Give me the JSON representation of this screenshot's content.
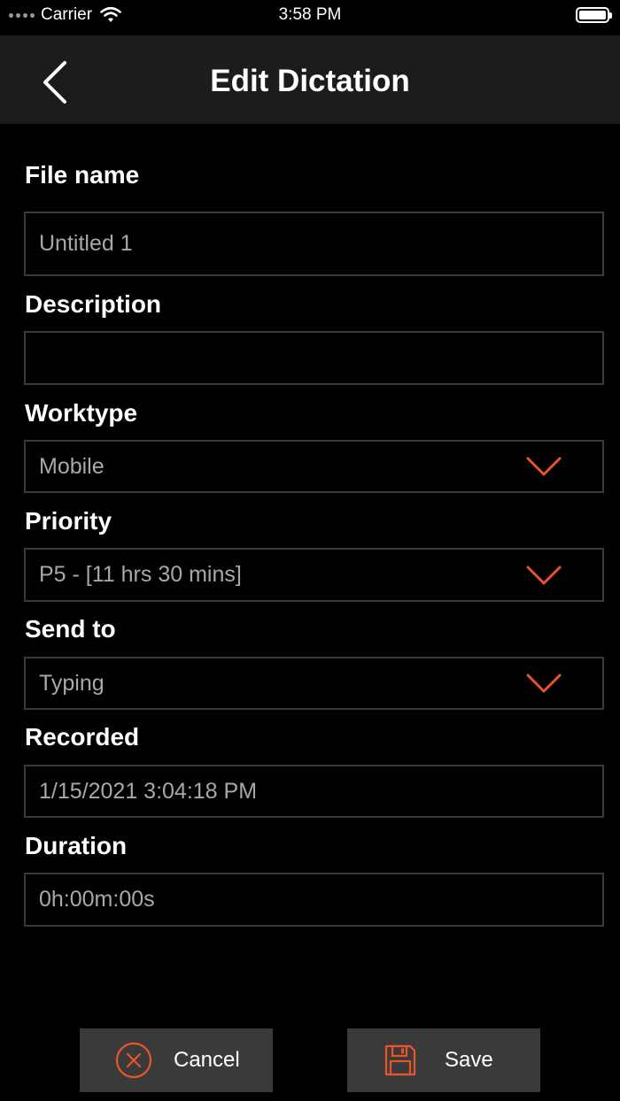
{
  "status_bar": {
    "carrier": "Carrier",
    "time": "3:58 PM"
  },
  "nav": {
    "title": "Edit Dictation",
    "back_icon": "chevron-left-icon"
  },
  "form": {
    "file_name": {
      "label": "File name",
      "value": "Untitled 1"
    },
    "description": {
      "label": "Description",
      "value": ""
    },
    "worktype": {
      "label": "Worktype",
      "value": "Mobile"
    },
    "priority": {
      "label": "Priority",
      "value": "P5 - [11 hrs 30 mins]"
    },
    "send_to": {
      "label": "Send to",
      "value": "Typing"
    },
    "recorded": {
      "label": "Recorded",
      "value": "1/15/2021 3:04:18 PM"
    },
    "duration": {
      "label": "Duration",
      "value": "0h:00m:00s"
    }
  },
  "buttons": {
    "cancel": "Cancel",
    "save": "Save"
  },
  "colors": {
    "accent": "#e8552a",
    "field_border": "#3a3a3a",
    "nav_bg": "#1c1c1c",
    "button_bg": "#3a3a3a"
  }
}
